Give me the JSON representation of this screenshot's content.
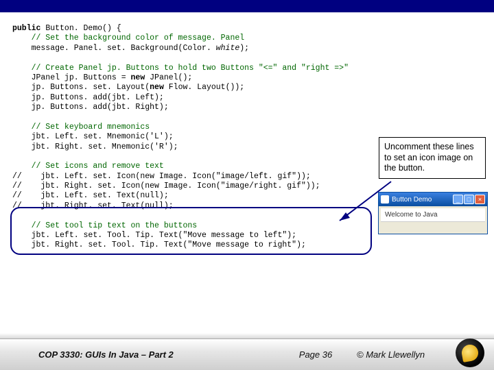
{
  "code": {
    "l1a": "public",
    "l1b": " Button. Demo() {",
    "l2": "    // Set the background color of message. Panel",
    "l3a": "    message. Panel. set. Background(Color. ",
    "l3b": "white",
    "l3c": ");",
    "l4": " ",
    "l5": "    // Create Panel jp. Buttons to hold two Buttons \"<=\" and \"right =>\"",
    "l6a": "    JPanel jp. Buttons = ",
    "l6b": "new",
    "l6c": " JPanel();",
    "l7a": "    jp. Buttons. set. Layout(",
    "l7b": "new",
    "l7c": " Flow. Layout());",
    "l8": "    jp. Buttons. add(jbt. Left);",
    "l9": "    jp. Buttons. add(jbt. Right);",
    "l10": " ",
    "l11": "    // Set keyboard mnemonics",
    "l12": "    jbt. Left. set. Mnemonic('L');",
    "l13": "    jbt. Right. set. Mnemonic('R');",
    "l14": " ",
    "l15": "    // Set icons and remove text",
    "l16": "//    jbt. Left. set. Icon(new Image. Icon(\"image/left. gif\"));",
    "l17": "//    jbt. Right. set. Icon(new Image. Icon(\"image/right. gif\"));",
    "l18": "//    jbt. Left. set. Text(null);",
    "l19": "//    jbt. Right. set. Text(null);",
    "l20": " ",
    "l21": "    // Set tool tip text on the buttons",
    "l22": "    jbt. Left. set. Tool. Tip. Text(\"Move message to left\");",
    "l23": "    jbt. Right. set. Tool. Tip. Text(\"Move message to right\");"
  },
  "callout": "Uncomment these lines to set an icon image on the button.",
  "mini": {
    "title": "Button Demo",
    "content": "Welcome to Java",
    "min": "_",
    "max": "□",
    "close": "×"
  },
  "footer": {
    "left": "COP 3330:  GUIs In Java – Part 2",
    "mid": "Page 36",
    "right": "© Mark Llewellyn"
  }
}
